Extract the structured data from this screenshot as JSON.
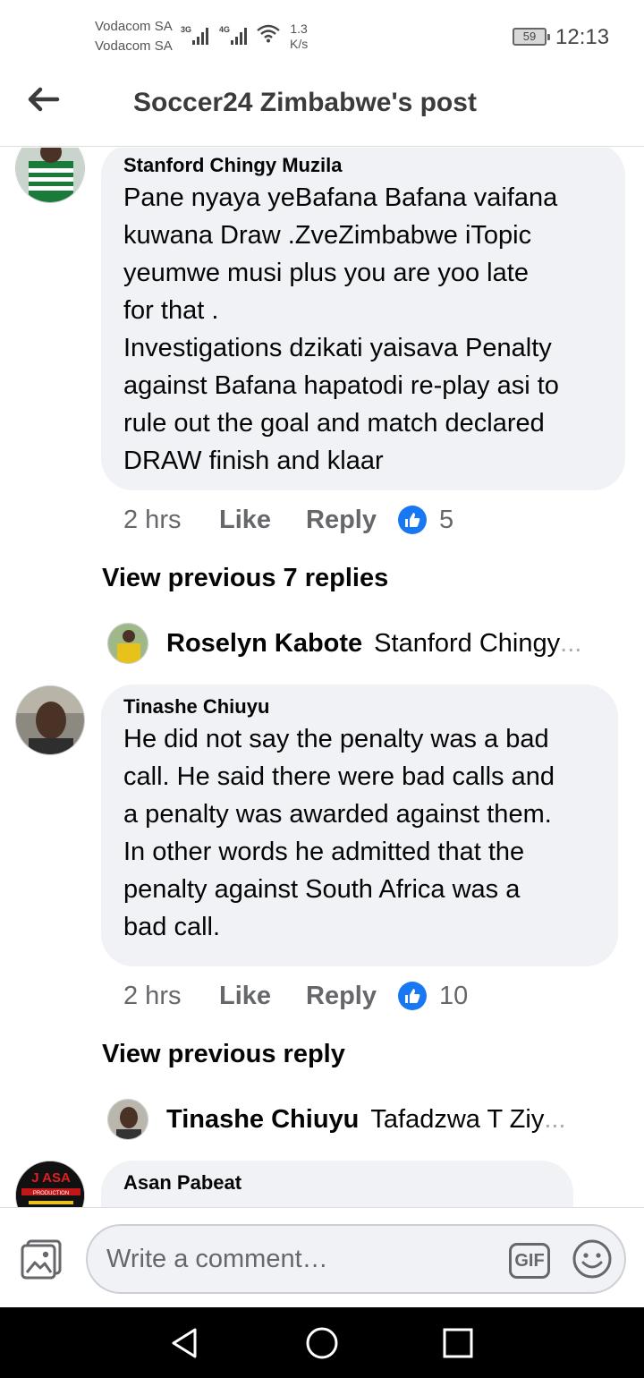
{
  "status_bar": {
    "carrier1": "Vodacom SA",
    "carrier2": "Vodacom SA",
    "net1": "3G",
    "net2": "4G",
    "speed_value": "1.3",
    "speed_unit": "K/s",
    "battery": "59",
    "time": "12:13"
  },
  "header": {
    "back_icon": "arrow-left-icon",
    "title": "Soccer24 Zimbabwe's post"
  },
  "comments": [
    {
      "author": "Stanford Chingy Muzila",
      "text": "Pane nyaya yeBafana Bafana vaifana\nkuwana Draw .ZveZimbabwe iTopic\nyeumwe musi plus you are yoo late\nfor that .\nInvestigations dzikati yaisava Penalty\nagainst Bafana hapatodi re-play asi to\nrule out the goal and match declared\nDRAW finish and klaar",
      "time": "2 hrs",
      "like_label": "Like",
      "reply_label": "Reply",
      "reactions": "5"
    },
    {
      "author": "Tinashe Chiuyu",
      "text": "He did not say the penalty was a bad\ncall. He said there were bad calls and\na penalty was awarded against them.\nIn other words he admitted that the\npenalty against South Africa was a\nbad call.",
      "time": "2 hrs",
      "like_label": "Like",
      "reply_label": "Reply",
      "reactions": "10"
    },
    {
      "author": "Asan Pabeat",
      "avatar_text": "J ASA",
      "avatar_subtext": "PRODUCTION"
    }
  ],
  "view_previous_1": "View previous 7 replies",
  "reply_preview_1": {
    "name": "Roselyn Kabote",
    "snippet": "Stanford Chingy",
    "dots": "..."
  },
  "view_previous_2": "View previous reply",
  "reply_preview_2": {
    "name": "Tinashe Chiuyu",
    "snippet": "Tafadzwa T Ziy",
    "dots": "..."
  },
  "comment_bar": {
    "placeholder": "Write a comment…",
    "gif_label": "GIF",
    "photo_icon": "photo-icon",
    "emoji_icon": "emoji-icon"
  },
  "nav": {
    "back": "back-triangle-icon",
    "home": "home-circle-icon",
    "recents": "recents-square-icon"
  },
  "colors": {
    "accent": "#1877f2",
    "bubble": "#f0f2f5",
    "meta": "#65676b"
  }
}
